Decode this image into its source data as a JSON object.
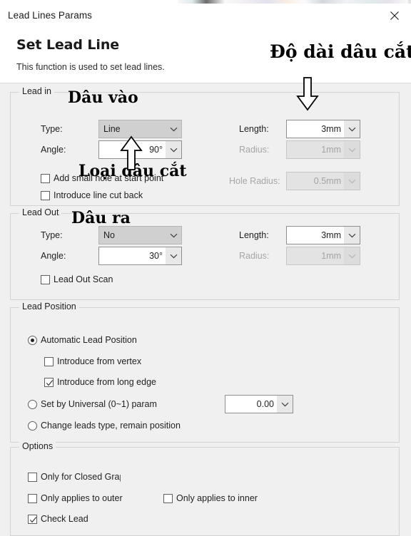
{
  "window": {
    "title": "Lead Lines Params",
    "close_icon": "close-icon"
  },
  "header": {
    "title": "Set Lead Line",
    "subtitle": "This function is used to set lead lines."
  },
  "annotations": [
    {
      "id": "do-dai",
      "text": "Độ dài dâu cắt"
    },
    {
      "id": "dau-vao",
      "text": "Dâu vào"
    },
    {
      "id": "loai",
      "text": "Loại dâu cắt"
    },
    {
      "id": "dau-ra",
      "text": "Dâu ra"
    }
  ],
  "lead_in": {
    "legend": "Lead in",
    "type_label": "Type:",
    "type_value": "Line",
    "angle_label": "Angle:",
    "angle_value": "90°",
    "length_label": "Length:",
    "length_value": "3mm",
    "radius_label": "Radius:",
    "radius_value": "1mm",
    "hole_radius_label": "Hole Radius:",
    "hole_radius_value": "0.5mm",
    "add_small_hole_label": "Add small hole at start point",
    "add_small_hole_checked": false,
    "cut_back_label": "Introduce line cut back",
    "cut_back_checked": false
  },
  "lead_out": {
    "legend": "Lead Out",
    "type_label": "Type:",
    "type_value": "No",
    "angle_label": "Angle:",
    "angle_value": "30°",
    "length_label": "Length:",
    "length_value": "3mm",
    "radius_label": "Radius:",
    "radius_value": "1mm",
    "scan_label": "Lead Out Scan",
    "scan_checked": false
  },
  "lead_position": {
    "legend": "Lead Position",
    "automatic_label": "Automatic Lead Position",
    "automatic_selected": true,
    "from_vertex_label": "Introduce from vertex",
    "from_vertex_checked": false,
    "from_long_edge_label": "Introduce from long edge",
    "from_long_edge_checked": true,
    "universal_label": "Set by Universal (0~1) param",
    "universal_selected": false,
    "universal_value": "0.00",
    "change_leads_label": "Change leads type, remain position",
    "change_leads_selected": false
  },
  "options": {
    "legend": "Options",
    "closed_graph_label": "Only for Closed Grap",
    "closed_graph_checked": false,
    "outer_label": "Only applies to outer",
    "outer_checked": false,
    "inner_label": "Only applies to inner",
    "inner_checked": false,
    "check_lead_label": "Check Lead",
    "check_lead_checked": true
  },
  "colors": {
    "dialog_bg": "#f0f0f0",
    "header_bg": "#ffffff",
    "group_border": "#d3d3d3",
    "text": "#1f1f1f",
    "disabled_text": "#a3a3a3"
  }
}
